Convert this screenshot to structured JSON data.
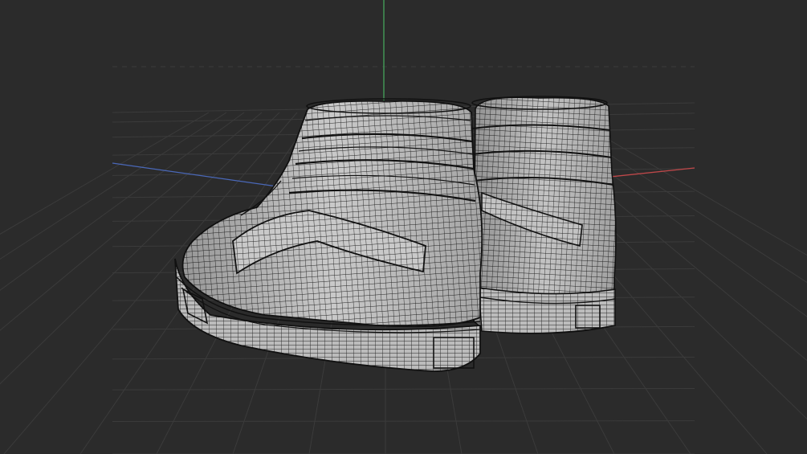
{
  "viewport": {
    "background_color": "#2b2b2b",
    "grid_color": "#3b3b3b",
    "axes": {
      "x_axis_color": "#c0484a",
      "y_axis_color": "#46a65a",
      "z_axis_color": "#4a68b8"
    },
    "render_mode": "wireframe-on-shaded",
    "objects": [
      {
        "name": "sneaker-front",
        "mesh_color": "#c9c9c9",
        "wire_color": "#1c1c1c"
      },
      {
        "name": "sneaker-back",
        "mesh_color": "#c4c4c4",
        "wire_color": "#1c1c1c"
      }
    ]
  }
}
